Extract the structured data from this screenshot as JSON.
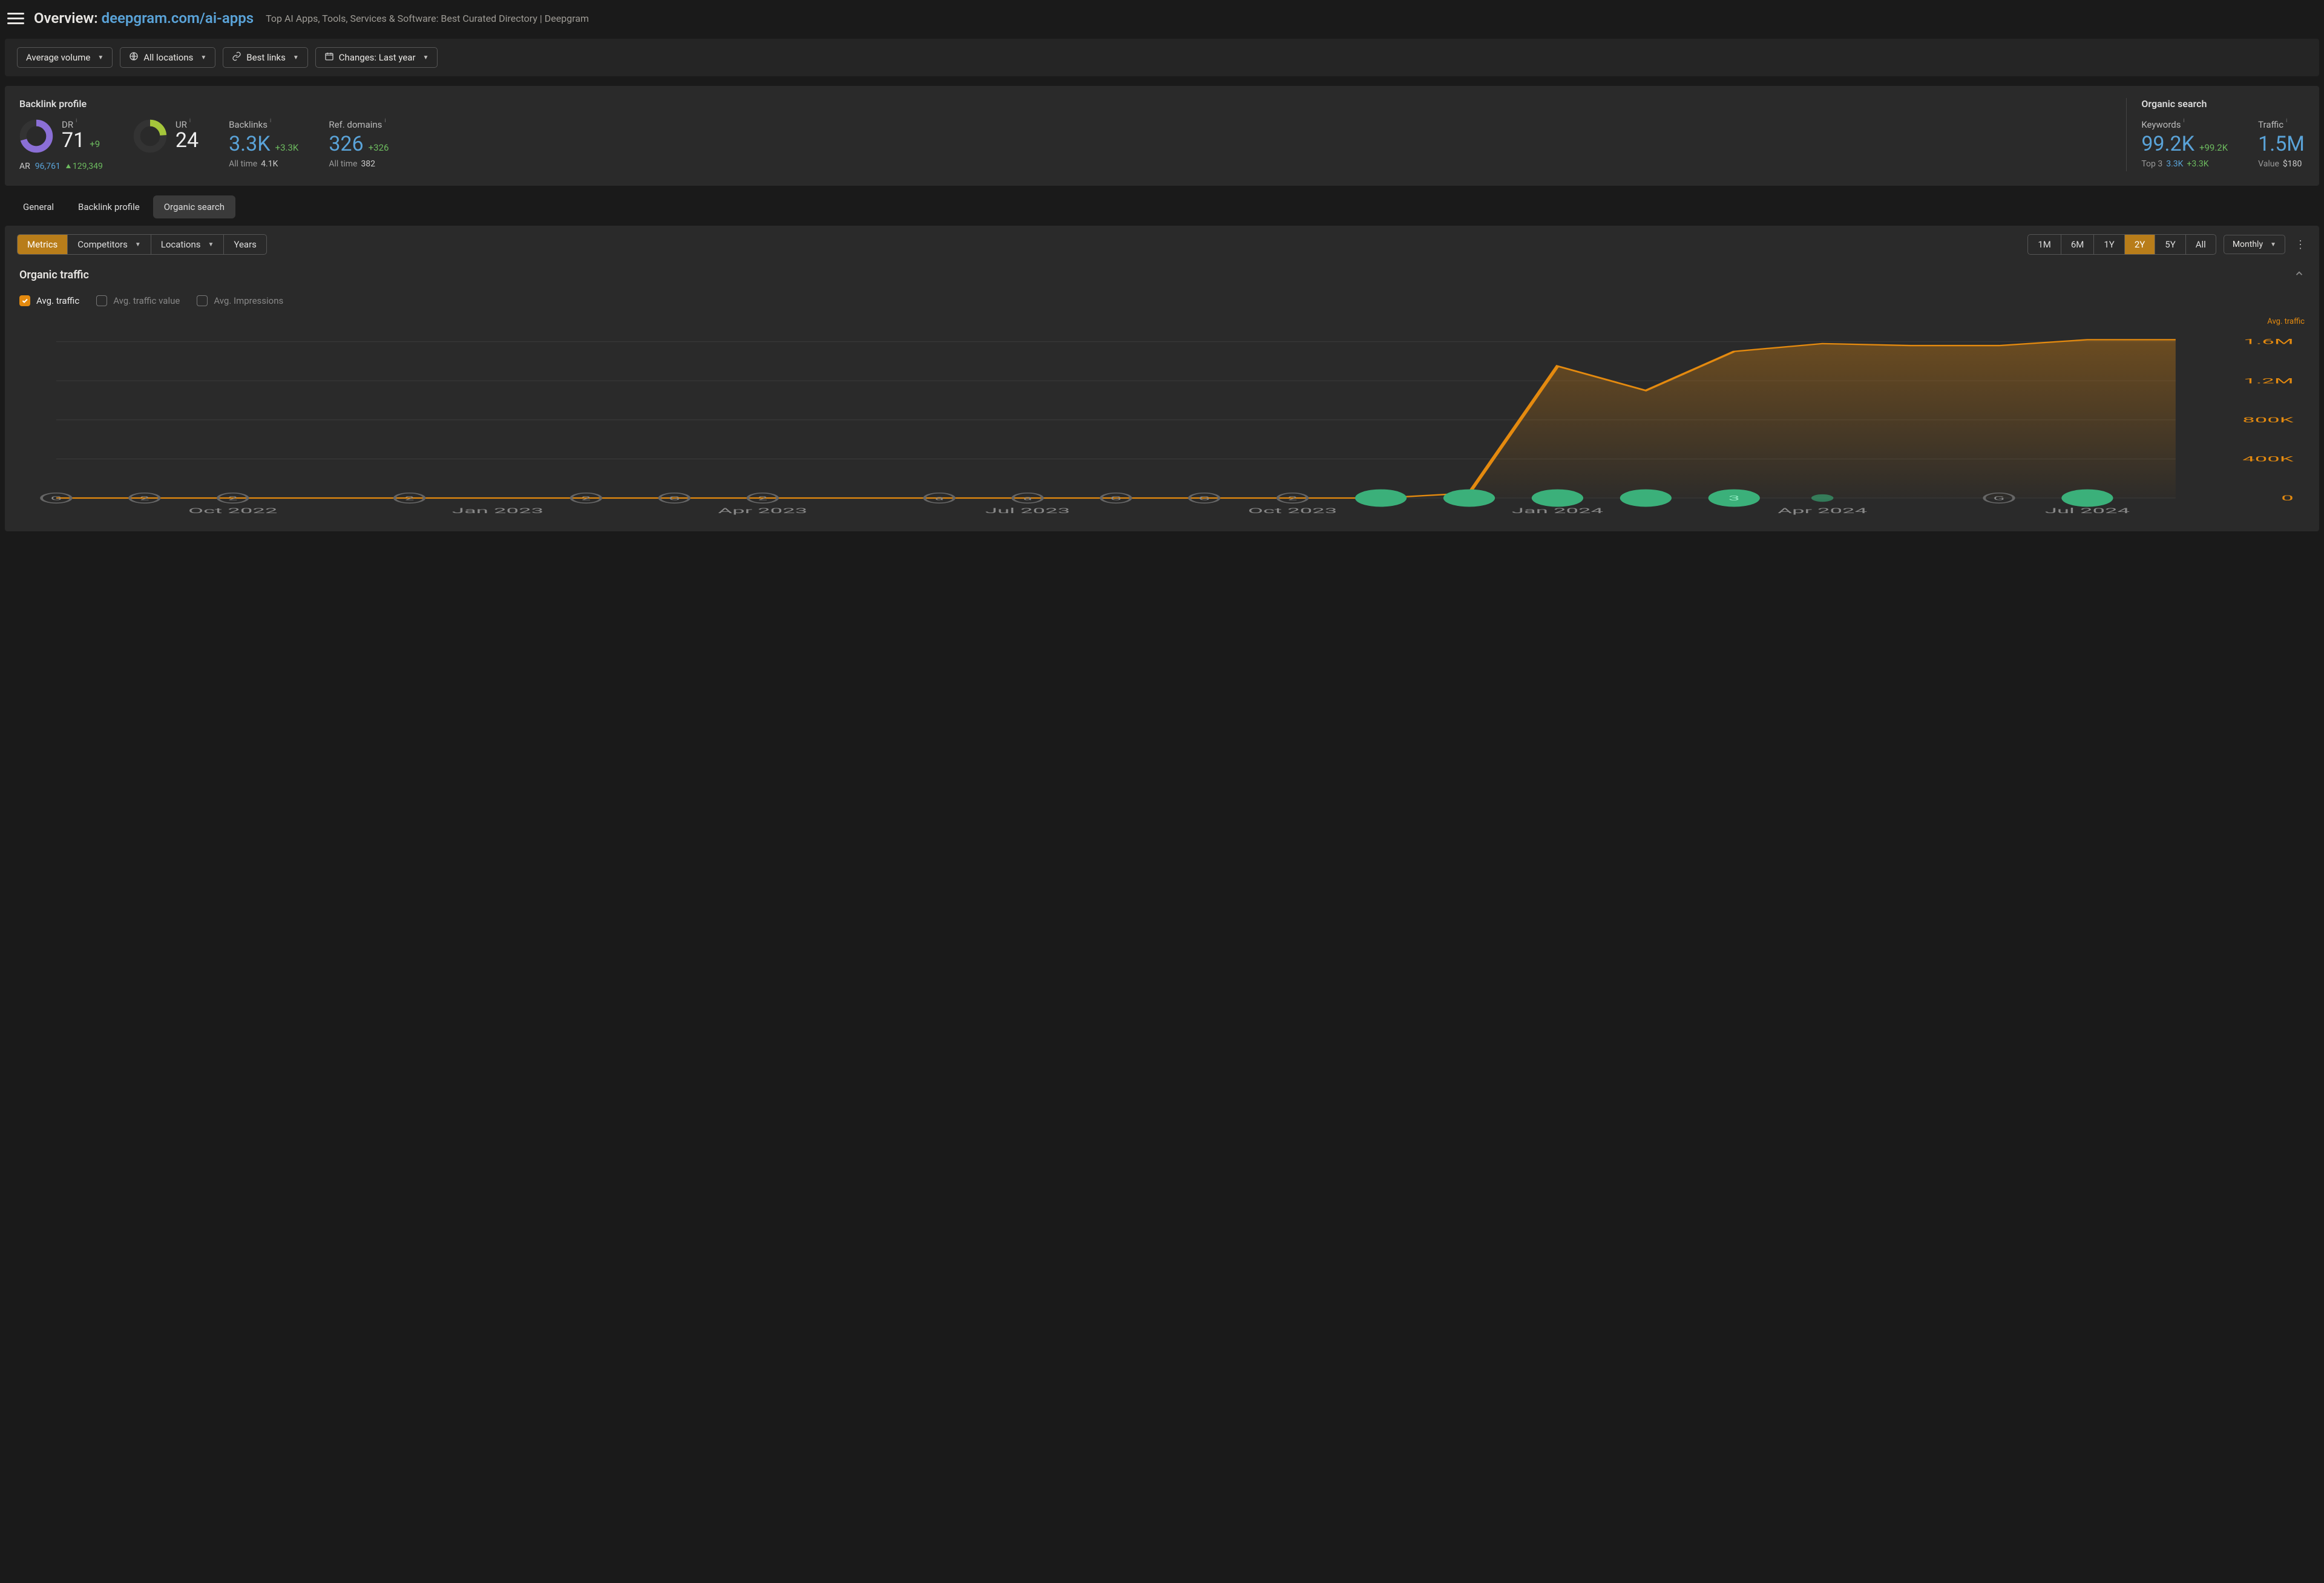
{
  "header": {
    "prefix": "Overview:",
    "url": "deepgram.com/ai-apps",
    "subtitle": "Top AI Apps, Tools, Services & Software: Best Curated Directory | Deepgram"
  },
  "filters": {
    "volume": "Average volume",
    "locations": "All locations",
    "links": "Best links",
    "changes": "Changes: Last year"
  },
  "backlink": {
    "title": "Backlink profile",
    "dr": {
      "label": "DR",
      "value": "71",
      "delta": "+9"
    },
    "ur": {
      "label": "UR",
      "value": "24"
    },
    "ar": {
      "label": "AR",
      "value": "96,761",
      "delta": "129,349"
    },
    "backlinks": {
      "label": "Backlinks",
      "value": "3.3K",
      "delta": "+3.3K",
      "alltime_label": "All time",
      "alltime": "4.1K"
    },
    "refdomains": {
      "label": "Ref. domains",
      "value": "326",
      "delta": "+326",
      "alltime_label": "All time",
      "alltime": "382"
    }
  },
  "organic": {
    "title": "Organic search",
    "keywords": {
      "label": "Keywords",
      "value": "99.2K",
      "delta": "+99.2K",
      "top3_label": "Top 3",
      "top3": "3.3K",
      "top3_delta": "+3.3K"
    },
    "traffic": {
      "label": "Traffic",
      "value": "1.5M",
      "value_label": "Value",
      "value_amt": "$180"
    }
  },
  "tabs": {
    "general": "General",
    "backlink": "Backlink profile",
    "organic": "Organic search"
  },
  "toolbar": {
    "metrics": "Metrics",
    "competitors": "Competitors",
    "locations": "Locations",
    "years": "Years",
    "ranges": {
      "m1": "1M",
      "m6": "6M",
      "y1": "1Y",
      "y2": "2Y",
      "y5": "5Y",
      "all": "All"
    },
    "granularity": "Monthly"
  },
  "panel": {
    "title": "Organic traffic",
    "checks": {
      "avg_traffic": "Avg. traffic",
      "avg_value": "Avg. traffic value",
      "avg_impr": "Avg. Impressions"
    },
    "ylabel": "Avg. traffic"
  },
  "chart_data": {
    "type": "area",
    "title": "Organic traffic",
    "ylabel": "Avg. traffic",
    "ylim": [
      0,
      1700000
    ],
    "yticks": [
      0,
      400000,
      800000,
      1200000,
      1600000
    ],
    "ytick_labels": [
      "0",
      "400K",
      "800K",
      "1.2M",
      "1.6M"
    ],
    "categories": [
      "Aug 2022",
      "Sep 2022",
      "Oct 2022",
      "Nov 2022",
      "Dec 2022",
      "Jan 2023",
      "Feb 2023",
      "Mar 2023",
      "Apr 2023",
      "May 2023",
      "Jun 2023",
      "Jul 2023",
      "Aug 2023",
      "Sep 2023",
      "Oct 2023",
      "Nov 2023",
      "Dec 2023",
      "Jan 2024",
      "Feb 2024",
      "Mar 2024",
      "Apr 2024",
      "May 2024",
      "Jun 2024",
      "Jul 2024",
      "Aug 2024"
    ],
    "x_tick_labels": [
      "Oct 2022",
      "Jan 2023",
      "Apr 2023",
      "Jul 2023",
      "Oct 2023",
      "Jan 2024",
      "Apr 2024",
      "Jul 2024"
    ],
    "series": [
      {
        "name": "Avg. traffic",
        "values": [
          0,
          0,
          0,
          0,
          0,
          0,
          0,
          0,
          0,
          0,
          0,
          0,
          0,
          0,
          0,
          0,
          50000,
          1350000,
          1100000,
          1500000,
          1580000,
          1560000,
          1560000,
          1620000,
          1620000
        ]
      }
    ],
    "markers": [
      {
        "x": "Aug 2022",
        "kind": "G"
      },
      {
        "x": "Sep 2022",
        "kind": "2"
      },
      {
        "x": "Oct 2022",
        "kind": "2"
      },
      {
        "x": "Dec 2022",
        "kind": "2"
      },
      {
        "x": "Feb 2023",
        "kind": "2"
      },
      {
        "x": "Mar 2023",
        "kind": "G"
      },
      {
        "x": "Apr 2023",
        "kind": "2"
      },
      {
        "x": "Jun 2023",
        "kind": "a"
      },
      {
        "x": "Jul 2023",
        "kind": "a"
      },
      {
        "x": "Aug 2023",
        "kind": "G"
      },
      {
        "x": "Sep 2023",
        "kind": "G"
      },
      {
        "x": "Oct 2023",
        "kind": "2"
      },
      {
        "x": "Nov 2023",
        "kind": "big"
      },
      {
        "x": "Dec 2023",
        "kind": "big"
      },
      {
        "x": "Jan 2024",
        "kind": "big"
      },
      {
        "x": "Feb 2024",
        "kind": "big"
      },
      {
        "x": "Mar 2024",
        "kind": "big-3"
      },
      {
        "x": "Apr 2024",
        "kind": "small"
      },
      {
        "x": "Jun 2024",
        "kind": "G"
      },
      {
        "x": "Jul 2024",
        "kind": "big"
      }
    ]
  }
}
